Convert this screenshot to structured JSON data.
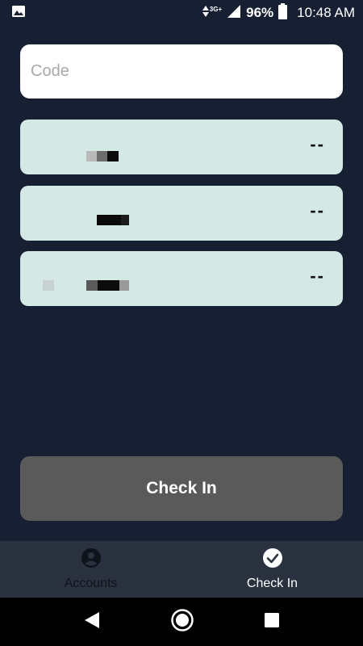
{
  "status_bar": {
    "network": "3G+",
    "battery": "96%",
    "time": "10:48 AM",
    "icons": [
      "image-notification-icon",
      "data-arrows-icon",
      "signal-icon",
      "battery-icon"
    ]
  },
  "code_input": {
    "placeholder": "Code",
    "value": ""
  },
  "accounts": [
    {
      "name": "",
      "code": "--"
    },
    {
      "name": "",
      "code": "--"
    },
    {
      "name": "",
      "code": "--"
    }
  ],
  "checkin_button": {
    "label": "Check In"
  },
  "bottom_nav": [
    {
      "label": "Accounts",
      "icon": "account-circle-icon",
      "active": false
    },
    {
      "label": "Check In",
      "icon": "check-circle-icon",
      "active": true
    }
  ],
  "colors": {
    "background": "#172033",
    "card": "#d4e9e5",
    "button_disabled": "#5a5a5a",
    "nav_bar": "#2a313f"
  }
}
